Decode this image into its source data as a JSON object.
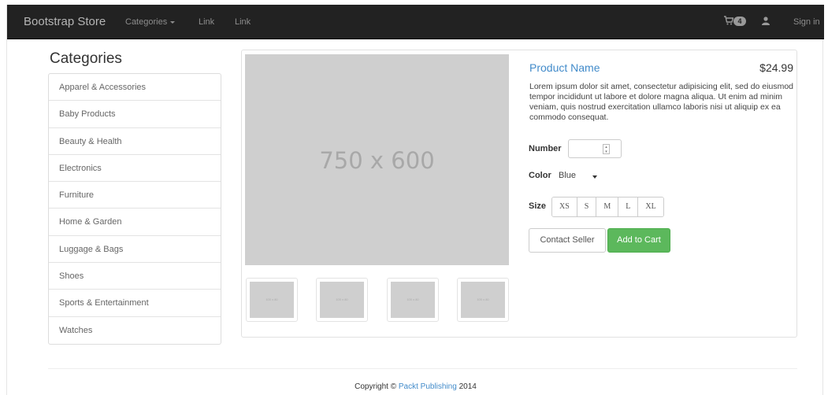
{
  "navbar": {
    "brand": "Bootstrap Store",
    "links": [
      {
        "label": "Categories",
        "has_caret": true
      },
      {
        "label": "Link"
      },
      {
        "label": "Link"
      }
    ],
    "cart_icon": "shopping-cart-icon",
    "cart_count": "4",
    "user_icon": "user-icon",
    "signin_label": "Sign in"
  },
  "sidebar": {
    "heading": "Categories",
    "items": [
      "Apparel & Accessories",
      "Baby Products",
      "Beauty & Health",
      "Electronics",
      "Furniture",
      "Home & Garden",
      "Luggage & Bags",
      "Shoes",
      "Sports & Entertainment",
      "Watches"
    ]
  },
  "product": {
    "main_image_label": "750 x 600",
    "thumbnail_label": "100 x 80",
    "name": "Product Name",
    "price": "$24.99",
    "description": "Lorem ipsum dolor sit amet, consectetur adipisicing elit, sed do eiusmod tempor incididunt ut labore et dolore magna aliqua. Ut enim ad minim veniam, quis nostrud exercitation ullamco laboris nisi ut aliquip ex ea commodo consequat.",
    "number_label": "Number",
    "number_value": "",
    "color_label": "Color",
    "color_value": "Blue",
    "size_label": "Size",
    "sizes": [
      "XS",
      "S",
      "M",
      "L",
      "XL"
    ],
    "contact_label": "Contact Seller",
    "add_label": "Add to Cart"
  },
  "footer": {
    "prefix": "Copyright © ",
    "link": "Packt Publishing",
    "suffix": " 2014"
  },
  "colors": {
    "navbar_bg": "#222222",
    "link_blue": "#428bca",
    "success_green": "#5cb85c",
    "placeholder_gray": "#cfcfcf"
  }
}
